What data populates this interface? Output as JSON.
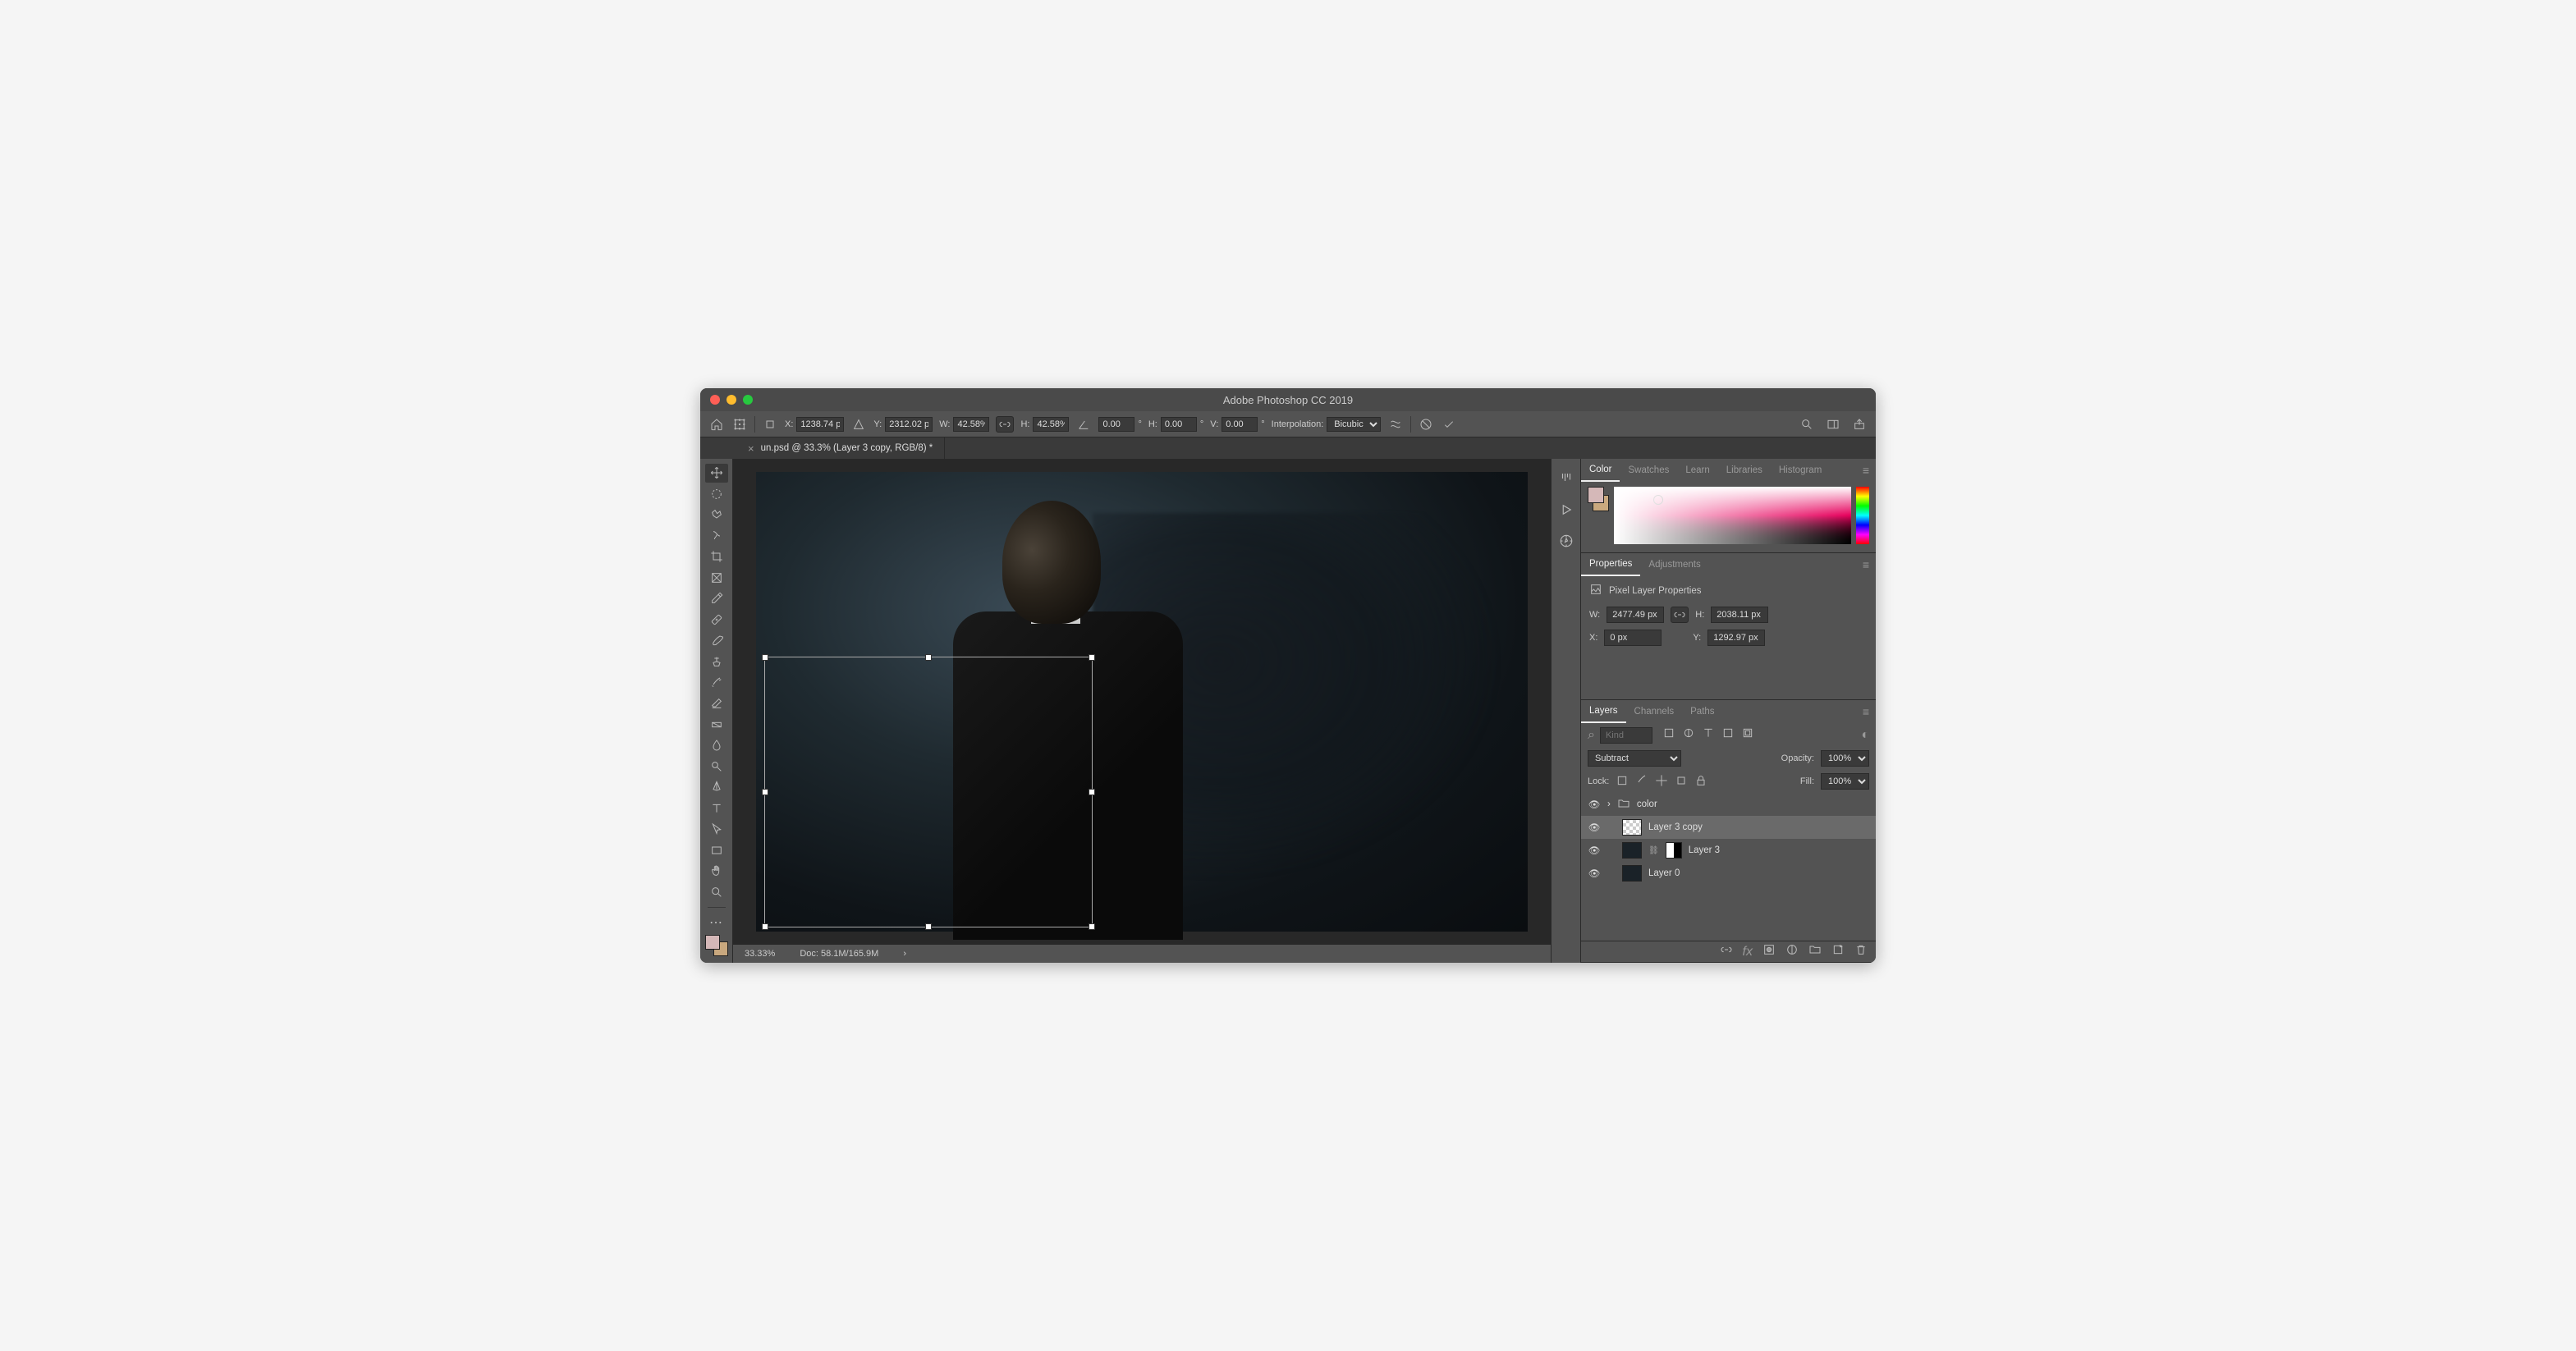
{
  "title": "Adobe Photoshop CC 2019",
  "optionsbar": {
    "x_label": "X:",
    "x": "1238.74 px",
    "y_label": "Y:",
    "y": "2312.02 px",
    "w_label": "W:",
    "w": "42.58%",
    "h_label": "H:",
    "h": "42.58%",
    "angle": "0.00",
    "hskew_label": "H:",
    "hskew": "0.00",
    "vskew_label": "V:",
    "vskew": "0.00",
    "interp_label": "Interpolation:",
    "interp": "Bicubic"
  },
  "doc": {
    "tab": "un.psd @ 33.3% (Layer 3 copy, RGB/8) *",
    "zoom": "33.33%",
    "docinfo": "Doc: 58.1M/165.9M"
  },
  "panels": {
    "color": {
      "tabs": [
        "Color",
        "Swatches",
        "Learn",
        "Libraries",
        "Histogram"
      ]
    },
    "props": {
      "tabs": [
        "Properties",
        "Adjustments"
      ],
      "subtitle": "Pixel Layer Properties",
      "w_label": "W:",
      "w": "2477.49 px",
      "h_label": "H:",
      "h": "2038.11 px",
      "x_label": "X:",
      "x": "0 px",
      "y_label": "Y:",
      "y": "1292.97 px"
    },
    "layers": {
      "tabs": [
        "Layers",
        "Channels",
        "Paths"
      ],
      "kind_placeholder": "Kind",
      "blend": "Subtract",
      "opacity_label": "Opacity:",
      "opacity": "100%",
      "lock_label": "Lock:",
      "fill_label": "Fill:",
      "fill": "100%",
      "items": [
        {
          "name": "color",
          "type": "group"
        },
        {
          "name": "Layer 3 copy",
          "type": "pixel",
          "selected": true
        },
        {
          "name": "Layer 3",
          "type": "pixel",
          "mask": true
        },
        {
          "name": "Layer 0",
          "type": "pixel"
        }
      ]
    }
  }
}
